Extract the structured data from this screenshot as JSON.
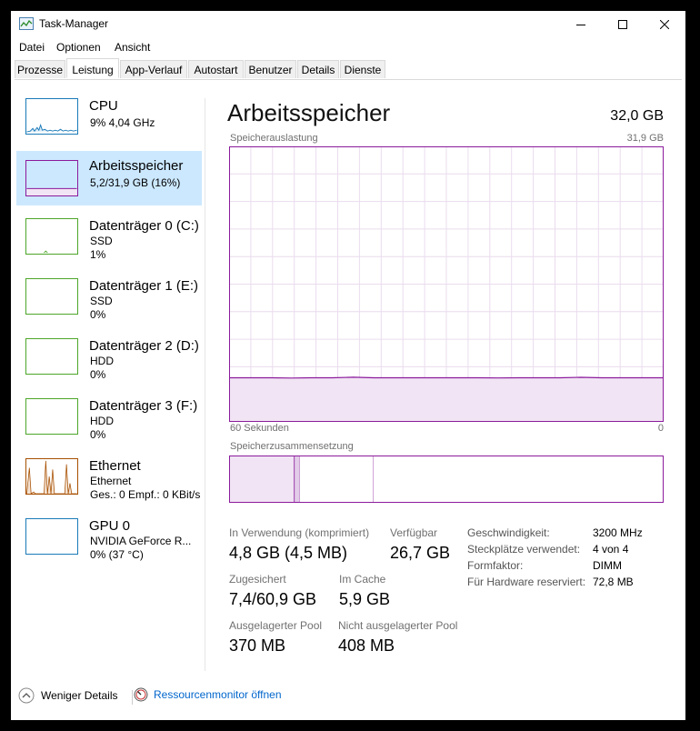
{
  "window": {
    "title": "Task-Manager",
    "icon": "task-manager-icon",
    "controls": [
      "minimize-icon",
      "maximize-icon",
      "close-icon"
    ]
  },
  "menu": [
    "Datei",
    "Optionen",
    "Ansicht"
  ],
  "tabs": [
    {
      "label": "Prozesse",
      "active": false
    },
    {
      "label": "Leistung",
      "active": true
    },
    {
      "label": "App-Verlauf",
      "active": false
    },
    {
      "label": "Autostart",
      "active": false
    },
    {
      "label": "Benutzer",
      "active": false
    },
    {
      "label": "Details",
      "active": false
    },
    {
      "label": "Dienste",
      "active": false
    }
  ],
  "sidebar": [
    {
      "name": "CPU",
      "line1": "9%  4,04 GHz",
      "line2": "",
      "color": "#1a7ab8",
      "selected": false
    },
    {
      "name": "Arbeitsspeicher",
      "line1": "5,2/31,9 GB (16%)",
      "line2": "",
      "color": "#8b1a9c",
      "selected": true
    },
    {
      "name": "Datenträger 0 (C:)",
      "line1": "SSD",
      "line2": "1%",
      "color": "#4da62a",
      "selected": false
    },
    {
      "name": "Datenträger 1 (E:)",
      "line1": "SSD",
      "line2": "0%",
      "color": "#4da62a",
      "selected": false
    },
    {
      "name": "Datenträger 2 (D:)",
      "line1": "HDD",
      "line2": "0%",
      "color": "#4da62a",
      "selected": false
    },
    {
      "name": "Datenträger 3 (F:)",
      "line1": "HDD",
      "line2": "0%",
      "color": "#4da62a",
      "selected": false
    },
    {
      "name": "Ethernet",
      "line1": "Ethernet",
      "line2": "Ges.: 0  Empf.: 0 KBit/s",
      "color": "#a74f00",
      "selected": false
    },
    {
      "name": "GPU 0",
      "line1": "NVIDIA GeForce R...",
      "line2": "0%  (37 °C)",
      "color": "#1a7ab8",
      "selected": false
    }
  ],
  "main": {
    "title": "Arbeitsspeicher",
    "total": "32,0 GB",
    "usage_label": "Speicherauslastung",
    "usage_max": "31,9 GB",
    "time_left": "60 Sekunden",
    "time_right": "0",
    "composition_label": "Speicherzusammensetzung",
    "usage_fraction": 0.16,
    "composition_fractions": {
      "in_use": 0.15,
      "modified": 0.012,
      "standby": 0.17,
      "free": 0.668
    },
    "accent_color": "#8b1a9c"
  },
  "stats": {
    "in_use_label": "In Verwendung (komprimiert)",
    "in_use_value": "4,8 GB (4,5 MB)",
    "available_label": "Verfügbar",
    "available_value": "26,7 GB",
    "committed_label": "Zugesichert",
    "committed_value": "7,4/60,9 GB",
    "cached_label": "Im Cache",
    "cached_value": "5,9 GB",
    "paged_label": "Ausgelagerter Pool",
    "paged_value": "370 MB",
    "nonpaged_label": "Nicht ausgelagerter Pool",
    "nonpaged_value": "408 MB"
  },
  "properties": [
    {
      "label": "Geschwindigkeit:",
      "value": "3200 MHz"
    },
    {
      "label": "Steckplätze verwendet:",
      "value": "4 von 4"
    },
    {
      "label": "Formfaktor:",
      "value": "DIMM"
    },
    {
      "label": "Für Hardware reserviert:",
      "value": "72,8 MB"
    }
  ],
  "footer": {
    "less_details": "Weniger Details",
    "resource_monitor": "Ressourcenmonitor öffnen"
  }
}
